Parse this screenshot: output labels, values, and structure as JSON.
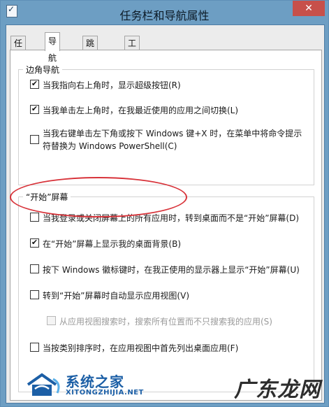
{
  "window": {
    "title": "任务栏和导航属性",
    "close_glyph": "✕"
  },
  "tabs": [
    {
      "label": "任务栏",
      "active": false
    },
    {
      "label": "导航",
      "active": true
    },
    {
      "label": "跳转列表",
      "active": false
    },
    {
      "label": "工具栏",
      "active": false
    }
  ],
  "corner_nav": {
    "title": "边角导航",
    "options": [
      {
        "label": "当我指向右上角时，显示超级按钮(R)",
        "checked": true
      },
      {
        "label": "当我单击左上角时，在我最近使用的应用之间切换(L)",
        "checked": true
      },
      {
        "label": "当我右键单击左下角或按下 Windows 键+X 时，在菜单中将命令提示符替换为 Windows PowerShell(C)",
        "checked": false
      }
    ]
  },
  "start_screen": {
    "title": "“开始”屏幕",
    "options": [
      {
        "label": "当我登录或关闭屏幕上的所有应用时，转到桌面而不是“开始”屏幕(D)",
        "checked": false
      },
      {
        "label": "在“开始”屏幕上显示我的桌面背景(B)",
        "checked": true
      },
      {
        "label": "按下 Windows 徽标键时，在我正使用的显示器上显示“开始”屏幕(U)",
        "checked": false
      },
      {
        "label": "转到“开始”屏幕时自动显示应用视图(V)",
        "checked": false
      },
      {
        "label": "从应用视图搜索时，搜索所有位置而不只搜索我的应用(S)",
        "checked": false,
        "disabled": true
      },
      {
        "label": "当按类别排序时，在应用视图中首先列出桌面应用(F)",
        "checked": false
      }
    ]
  },
  "watermarks": {
    "left_title": "系统之家",
    "left_sub": "XITONGZHIJIA.NET",
    "right_text": "广东龙网"
  },
  "colors": {
    "titlebar": "#6d9ec3",
    "close_button": "#c7504a",
    "highlight_ellipse": "#d8333a",
    "watermark_blue": "#1c5fa6"
  }
}
